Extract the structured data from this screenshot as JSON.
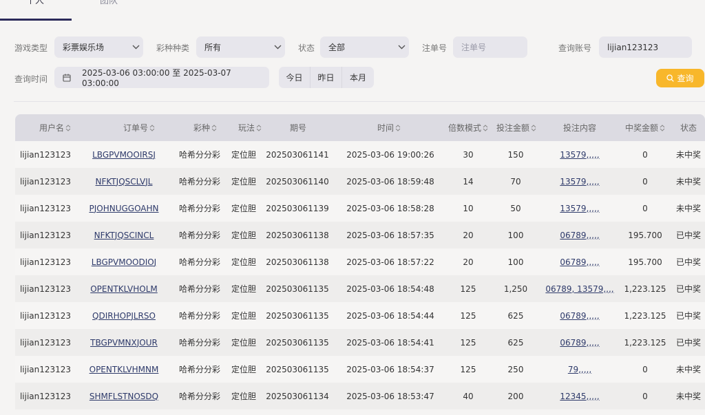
{
  "tabs": [
    {
      "label": "个人"
    },
    {
      "label": "团队"
    }
  ],
  "filters": {
    "game_type_label": "游戏类型",
    "game_type_value": "彩票娱乐场",
    "lottery_type_label": "彩种种类",
    "lottery_type_value": "所有",
    "status_label": "状态",
    "status_value": "全部",
    "order_no_label": "注单号",
    "order_no_placeholder": "注单号",
    "account_label": "查询账号",
    "account_value": "lijian123123",
    "time_label": "查询时间",
    "time_range": "2025-03-06 03:00:00 至 2025-03-07 03:00:00",
    "quick": [
      "今日",
      "昨日",
      "本月"
    ],
    "query_label": "查询"
  },
  "table": {
    "headers": [
      "用户名",
      "订单号",
      "彩种",
      "玩法",
      "期号",
      "时间",
      "倍数模式",
      "投注金额",
      "投注内容",
      "中奖金额",
      "状态"
    ],
    "rows": [
      {
        "user": "lijian123123",
        "order": "LBGPVMOOIRSJ",
        "lottery": "哈希分分彩",
        "play": "定位胆",
        "issue": "202503061141",
        "time": "2025-03-06 19:00:26",
        "mult": "30",
        "amount": "150",
        "content": "13579,,,,,",
        "win": "0",
        "status": "未中奖"
      },
      {
        "user": "lijian123123",
        "order": "NFKTJQSCLVJL",
        "lottery": "哈希分分彩",
        "play": "定位胆",
        "issue": "202503061140",
        "time": "2025-03-06 18:59:48",
        "mult": "14",
        "amount": "70",
        "content": "13579,,,,,",
        "win": "0",
        "status": "未中奖"
      },
      {
        "user": "lijian123123",
        "order": "PJOHNUGGOAHN",
        "lottery": "哈希分分彩",
        "play": "定位胆",
        "issue": "202503061139",
        "time": "2025-03-06 18:58:28",
        "mult": "10",
        "amount": "50",
        "content": "13579,,,,,",
        "win": "0",
        "status": "未中奖"
      },
      {
        "user": "lijian123123",
        "order": "NFKTJQSCINCL",
        "lottery": "哈希分分彩",
        "play": "定位胆",
        "issue": "202503061138",
        "time": "2025-03-06 18:57:35",
        "mult": "20",
        "amount": "100",
        "content": "06789,,,,,",
        "win": "195.700",
        "status": "已中奖"
      },
      {
        "user": "lijian123123",
        "order": "LBGPVMOODIOJ",
        "lottery": "哈希分分彩",
        "play": "定位胆",
        "issue": "202503061138",
        "time": "2025-03-06 18:57:22",
        "mult": "20",
        "amount": "100",
        "content": "06789,,,,,",
        "win": "195.700",
        "status": "已中奖"
      },
      {
        "user": "lijian123123",
        "order": "OPENTKLVHOLM",
        "lottery": "哈希分分彩",
        "play": "定位胆",
        "issue": "202503061135",
        "time": "2025-03-06 18:54:48",
        "mult": "125",
        "amount": "1,250",
        "content": "06789, 13579,,,,",
        "win": "1,223.125",
        "status": "已中奖"
      },
      {
        "user": "lijian123123",
        "order": "QDIRHOPJLRSO",
        "lottery": "哈希分分彩",
        "play": "定位胆",
        "issue": "202503061135",
        "time": "2025-03-06 18:54:44",
        "mult": "125",
        "amount": "625",
        "content": "06789,,,,,",
        "win": "1,223.125",
        "status": "已中奖"
      },
      {
        "user": "lijian123123",
        "order": "TBGPVMNXJOUR",
        "lottery": "哈希分分彩",
        "play": "定位胆",
        "issue": "202503061135",
        "time": "2025-03-06 18:54:41",
        "mult": "125",
        "amount": "625",
        "content": "06789,,,,,",
        "win": "1,223.125",
        "status": "已中奖"
      },
      {
        "user": "lijian123123",
        "order": "OPENTKLVHMNM",
        "lottery": "哈希分分彩",
        "play": "定位胆",
        "issue": "202503061135",
        "time": "2025-03-06 18:54:37",
        "mult": "125",
        "amount": "250",
        "content": "79,,,,,",
        "win": "0",
        "status": "未中奖"
      },
      {
        "user": "lijian123123",
        "order": "SHMFLSTNOSDQ",
        "lottery": "哈希分分彩",
        "play": "定位胆",
        "issue": "202503061134",
        "time": "2025-03-06 18:53:47",
        "mult": "40",
        "amount": "200",
        "content": "12345,,,,,",
        "win": "0",
        "status": "未中奖"
      }
    ]
  }
}
